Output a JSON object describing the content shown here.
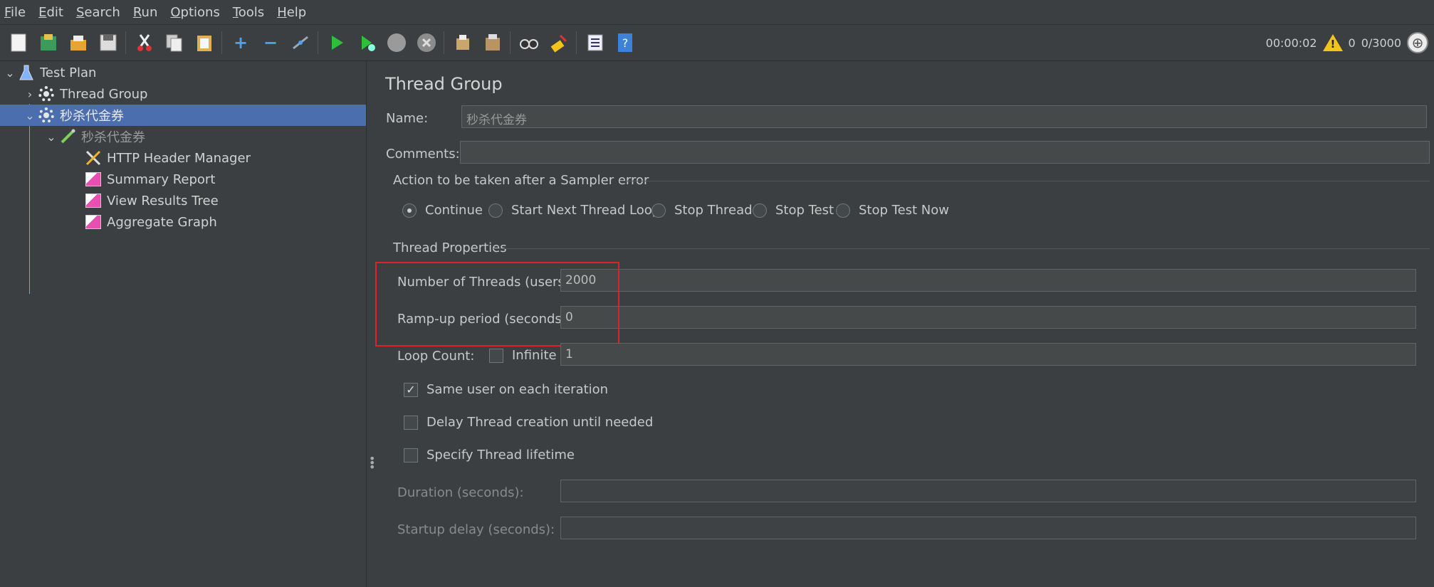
{
  "menu": [
    {
      "mn": "F",
      "rest": "ile"
    },
    {
      "mn": "E",
      "rest": "dit"
    },
    {
      "mn": "S",
      "rest": "earch"
    },
    {
      "mn": "R",
      "rest": "un"
    },
    {
      "mn": "O",
      "rest": "ptions"
    },
    {
      "mn": "T",
      "rest": "ools"
    },
    {
      "mn": "H",
      "rest": "elp"
    }
  ],
  "toolbar": {
    "buttons": [
      "new-icon",
      "templates-icon",
      "open-icon",
      "save-icon",
      "cut-icon",
      "copy-icon",
      "paste-icon",
      "expand-icon",
      "collapse-icon",
      "toggle-icon",
      "start-icon",
      "start-no-pauses-icon",
      "stop-icon",
      "shutdown-icon",
      "clear-icon",
      "clear-all-icon",
      "search-icon",
      "reset-search-icon",
      "function-helper-icon",
      "help-icon"
    ],
    "timer": "00:00:02",
    "warnings": "0",
    "threads": "0/3000"
  },
  "tree": {
    "test_plan": "Test Plan",
    "thread_group": "Thread Group",
    "selected_group": "秒杀代金券",
    "sampler": "秒杀代金券",
    "children": [
      "HTTP Header Manager",
      "Summary Report",
      "View Results Tree",
      "Aggregate Graph"
    ]
  },
  "panel": {
    "title": "Thread Group",
    "name_label": "Name:",
    "name_value": "秒杀代金券",
    "comments_label": "Comments:",
    "comments_value": "",
    "error_section": "Action to be taken after a Sampler error",
    "error_options": [
      "Continue",
      "Start Next Thread Loop",
      "Stop Thread",
      "Stop Test",
      "Stop Test Now"
    ],
    "error_selected": "Continue",
    "props_section": "Thread Properties",
    "threads_label": "Number of Threads (users):",
    "threads_value": "2000",
    "rampup_label": "Ramp-up period (seconds):",
    "rampup_value": "0",
    "loop_label": "Loop Count:",
    "infinite_label": "Infinite",
    "infinite_checked": false,
    "loop_value": "1",
    "same_user_label": "Same user on each iteration",
    "same_user_checked": true,
    "delay_label": "Delay Thread creation until needed",
    "delay_checked": false,
    "lifetime_label": "Specify Thread lifetime",
    "lifetime_checked": false,
    "duration_label": "Duration (seconds):",
    "duration_value": "",
    "startup_label": "Startup delay (seconds):",
    "startup_value": ""
  },
  "colors": {
    "background": "#3c3f41",
    "selection": "#4b6eaf",
    "highlight_box": "#e0202a"
  }
}
